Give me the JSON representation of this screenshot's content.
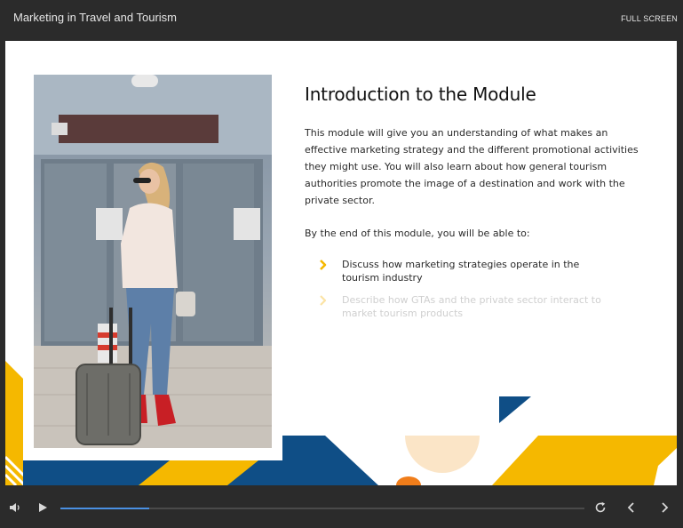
{
  "header": {
    "course_title": "Marketing in Travel and Tourism",
    "fullscreen_label": "FULL SCREEN"
  },
  "slide": {
    "title": "Introduction to the Module",
    "intro": "This module will give you an understanding of what makes an effective marketing strategy and the different promotional activities they might use. You will also learn about how general tourism authorities promote the image of a destination and work with the private sector.",
    "lead_in": "By the end of this module, you will be able to:",
    "objectives": [
      "Discuss how marketing strategies operate in the tourism industry",
      "Describe how GTAs and the private sector interact to market tourism products"
    ],
    "accent_color": "#f5b800",
    "brand_blue": "#0f4e86"
  },
  "player": {
    "progress": 0.17,
    "progress_color": "#4a90e2",
    "icons": [
      "volume-icon",
      "play-icon",
      "replay-icon",
      "previous-icon",
      "next-icon"
    ]
  }
}
